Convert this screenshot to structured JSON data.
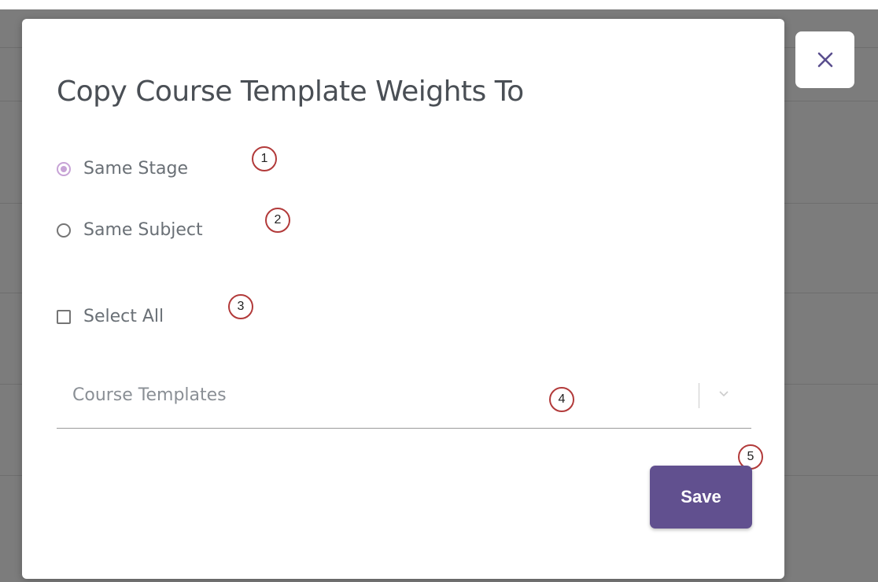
{
  "dialog": {
    "title": "Copy Course Template Weights To",
    "options": [
      {
        "label": "Same Stage",
        "type": "radio",
        "checked": true,
        "marker": "1"
      },
      {
        "label": "Same Subject",
        "type": "radio",
        "checked": false,
        "marker": "2"
      }
    ],
    "select_all": {
      "label": "Select All",
      "checked": false,
      "marker": "3"
    },
    "course_templates": {
      "placeholder": "Course Templates",
      "marker": "4"
    },
    "save": {
      "label": "Save",
      "marker": "5"
    },
    "close_icon": "close-icon"
  },
  "colors": {
    "accent_button": "#61508f",
    "radio_checked": "#c7a3d6",
    "marker_border": "#b23a3a"
  }
}
